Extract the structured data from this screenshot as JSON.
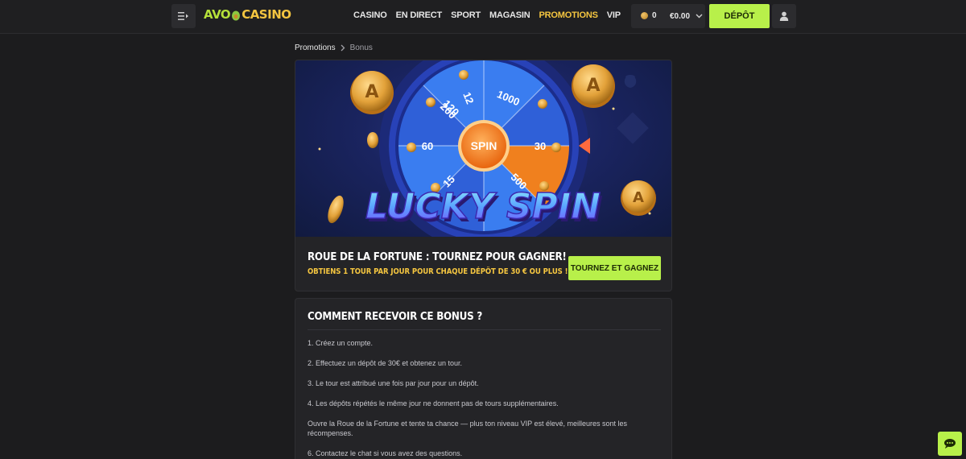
{
  "header": {
    "logo_avo": "AVO",
    "logo_casino": "CASINO",
    "nav": [
      {
        "label": "CASINO",
        "active": false
      },
      {
        "label": "EN DIRECT",
        "active": false
      },
      {
        "label": "SPORT",
        "active": false
      },
      {
        "label": "MAGASIN",
        "active": false
      },
      {
        "label": "PROMOTIONS",
        "active": true
      },
      {
        "label": "VIP",
        "active": false
      }
    ],
    "coins": "0",
    "balance": "€0.00",
    "deposit_label": "DÉPÔT"
  },
  "breadcrumb": {
    "parent": "Promotions",
    "current": "Bonus"
  },
  "promo": {
    "banner_text": "LUCKY SPIN",
    "wheel_center": "SPIN",
    "wheel_values": [
      "1000",
      "12",
      "120",
      "30",
      "500",
      "15",
      "60",
      "200"
    ],
    "title": "ROUE DE LA FORTUNE : TOURNEZ POUR GAGNER!",
    "subtitle": "OBTIENS 1 TOUR PAR JOUR POUR CHAQUE DÉPÔT DE 30 € OU PLUS !",
    "button_label": "TOURNEZ ET GAGNEZ"
  },
  "info": {
    "title": "COMMENT RECEVOIR CE BONUS ?",
    "steps": [
      "1. Créez un compte.",
      "2. Effectuez un dépôt de 30€ et obtenez un tour.",
      "3. Le tour est attribué une fois par jour pour un dépôt.",
      "4. Les dépôts répétés le même jour ne donnent pas de tours supplémentaires.",
      "Ouvre la Roue de la Fortune et tente ta chance — plus ton niveau VIP est élevé, meilleures sont les récompenses.",
      "6. Contactez le chat si vous avez des questions."
    ]
  },
  "colors": {
    "accent_green": "#b8f04a",
    "accent_yellow": "#f5c640",
    "background": "#1c1c1e"
  }
}
